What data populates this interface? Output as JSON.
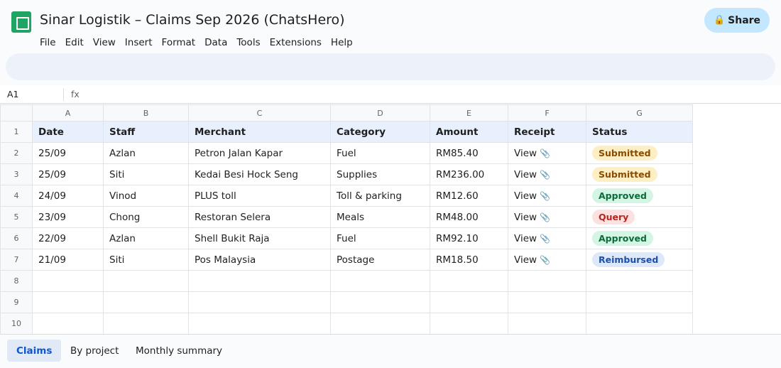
{
  "app": {
    "title": "Sinar Logistik – Claims Sep 2026 (ChatsHero)",
    "logo_icon": "sheets-logo-icon",
    "share_label": "Share",
    "share_icon": "🔒"
  },
  "menu": [
    "File",
    "Edit",
    "View",
    "Insert",
    "Format",
    "Data",
    "Tools",
    "Extensions",
    "Help"
  ],
  "formula_bar": {
    "cell_ref": "A1",
    "fx_label": "fx"
  },
  "grid": {
    "columns": [
      "A",
      "B",
      "C",
      "D",
      "E",
      "F",
      "G"
    ],
    "row_numbers": [
      "1",
      "2",
      "3",
      "4",
      "5",
      "6",
      "7",
      "8",
      "9",
      "10"
    ],
    "headers": [
      "Date",
      "Staff",
      "Merchant",
      "Category",
      "Amount",
      "Receipt",
      "Status"
    ],
    "receipt_icon": "📎",
    "rows": [
      [
        "25/09",
        "Azlan",
        "Petron Jalan Kapar",
        "Fuel",
        "RM85.40",
        "View",
        "Submitted"
      ],
      [
        "25/09",
        "Siti",
        "Kedai Besi Hock Seng",
        "Supplies",
        "RM236.00",
        "View",
        "Submitted"
      ],
      [
        "24/09",
        "Vinod",
        "PLUS toll",
        "Toll & parking",
        "RM12.60",
        "View",
        "Approved"
      ],
      [
        "23/09",
        "Chong",
        "Restoran Selera",
        "Meals",
        "RM48.00",
        "View",
        "Query"
      ],
      [
        "22/09",
        "Azlan",
        "Shell Bukit Raja",
        "Fuel",
        "RM92.10",
        "View",
        "Approved"
      ],
      [
        "21/09",
        "Siti",
        "Pos Malaysia",
        "Postage",
        "RM18.50",
        "View",
        "Reimbursed"
      ]
    ]
  },
  "status_colors": {
    "Submitted": {
      "bg": "#fdefc3",
      "fg": "#8a4b00"
    },
    "Approved": {
      "bg": "#d3f5e3",
      "fg": "#0d6b3a"
    },
    "Query": {
      "bg": "#fde0e0",
      "fg": "#b3261e"
    },
    "Reimbursed": {
      "bg": "#dde8fb",
      "fg": "#1c4fa8"
    }
  },
  "sheet_tabs": [
    {
      "label": "Claims",
      "active": true
    },
    {
      "label": "By project",
      "active": false
    },
    {
      "label": "Monthly summary",
      "active": false
    }
  ]
}
